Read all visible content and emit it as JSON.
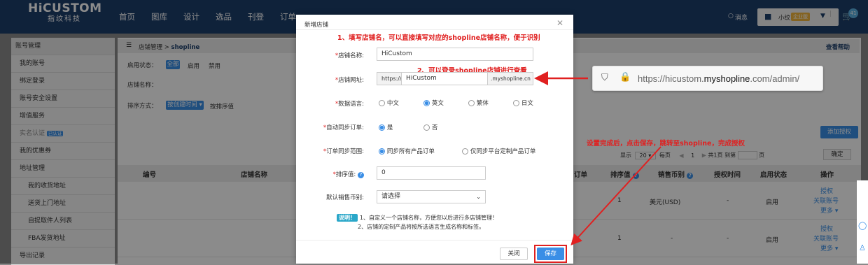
{
  "logo": {
    "name": "HiCUSTOM",
    "sub": "指纹科技"
  },
  "nav": [
    "首页",
    "图库",
    "设计",
    "选品",
    "刊登",
    "订单"
  ],
  "header_right": {
    "messages": "消息",
    "user": "小纹",
    "vip": "企业版",
    "cart_count": "41"
  },
  "sidebar": {
    "items": [
      "账号管理",
      "我的账号",
      "绑定登录",
      "账号安全设置",
      "增值服务",
      "实名认证",
      "我的优惠券",
      "地址管理",
      "我的收货地址",
      "送货上门地址",
      "自提取件人列表",
      "FBA发货地址",
      "导出记录"
    ],
    "verified_badge": "已认证"
  },
  "main": {
    "breadcrumb_a": "店铺管理 > ",
    "breadcrumb_b": "shopline",
    "help_link": "查看帮助",
    "auth_status_label": "启用状态：",
    "auth_status_options": [
      "全部",
      "启用",
      "禁用"
    ],
    "store_name_label": "店铺名称：",
    "sort_label": "排序方式：",
    "sort_selected": "按创建时间",
    "sort_other": "按排序值",
    "add_auth_button": "添加授权",
    "pager": {
      "show": "显示",
      "per": "20",
      "per_page": "每页",
      "page": "1",
      "total": "共1页",
      "goto": "到第",
      "page_unit": "页",
      "confirm": "确定"
    },
    "table_headers": [
      "编号",
      "店铺名称",
      "订单",
      "排序值",
      "销售币别",
      "授权时间",
      "启用状态",
      "操作"
    ],
    "rows": [
      {
        "sort": "1",
        "currency": "美元(USD)",
        "auth_time": "-",
        "status": "启用",
        "ops": [
          "授权",
          "关联账号",
          "更多"
        ]
      },
      {
        "sort": "1",
        "currency": "-",
        "auth_time": "-",
        "status": "启用",
        "ops": [
          "授权",
          "关联账号",
          "更多"
        ]
      }
    ]
  },
  "modal": {
    "title": "新增店铺",
    "store_name_label": "店铺名称:",
    "store_name_value": "HiCustom",
    "store_url_label": "店铺网址:",
    "url_prefix": "https://",
    "url_value": "HiCustom",
    "url_suffix": ".myshopline.cn",
    "language_label": "数据语言:",
    "languages": [
      "中文",
      "英文",
      "繁体",
      "日文"
    ],
    "auto_sync_label": "自动同步订单:",
    "auto_sync_options": [
      "是",
      "否"
    ],
    "sync_scope_label": "订单同步范围:",
    "sync_scope_options": [
      "同步所有产品订单",
      "仅同步平台定制产品订单"
    ],
    "sort_label": "排序值:",
    "sort_value": "0",
    "currency_label": "默认销售币别:",
    "currency_placeholder": "请选择",
    "note_tag": "说明！",
    "note_1": "1、自定义一个店铺名称，方便您以后进行多店铺管理！",
    "note_2": "2、店铺的定制产品将按所选语言生成名称和标签。",
    "close_button": "关闭",
    "save_button": "保存"
  },
  "annotations": {
    "a1": "1、填写店铺名，可以直接填写对应的shopline店铺名称，便于识别",
    "a2": "2、可以登录shopline店铺进行查看",
    "a3": "设置完成后，点击保存，跳转至shopline，完成授权",
    "url_host_a": "https://hicustom.",
    "url_host_b": "myshopline",
    "url_host_c": ".com/admin/"
  },
  "colors": {
    "topbar": "#1d3e6b",
    "accent": "#3a8ee6",
    "annotation": "#e02020"
  }
}
